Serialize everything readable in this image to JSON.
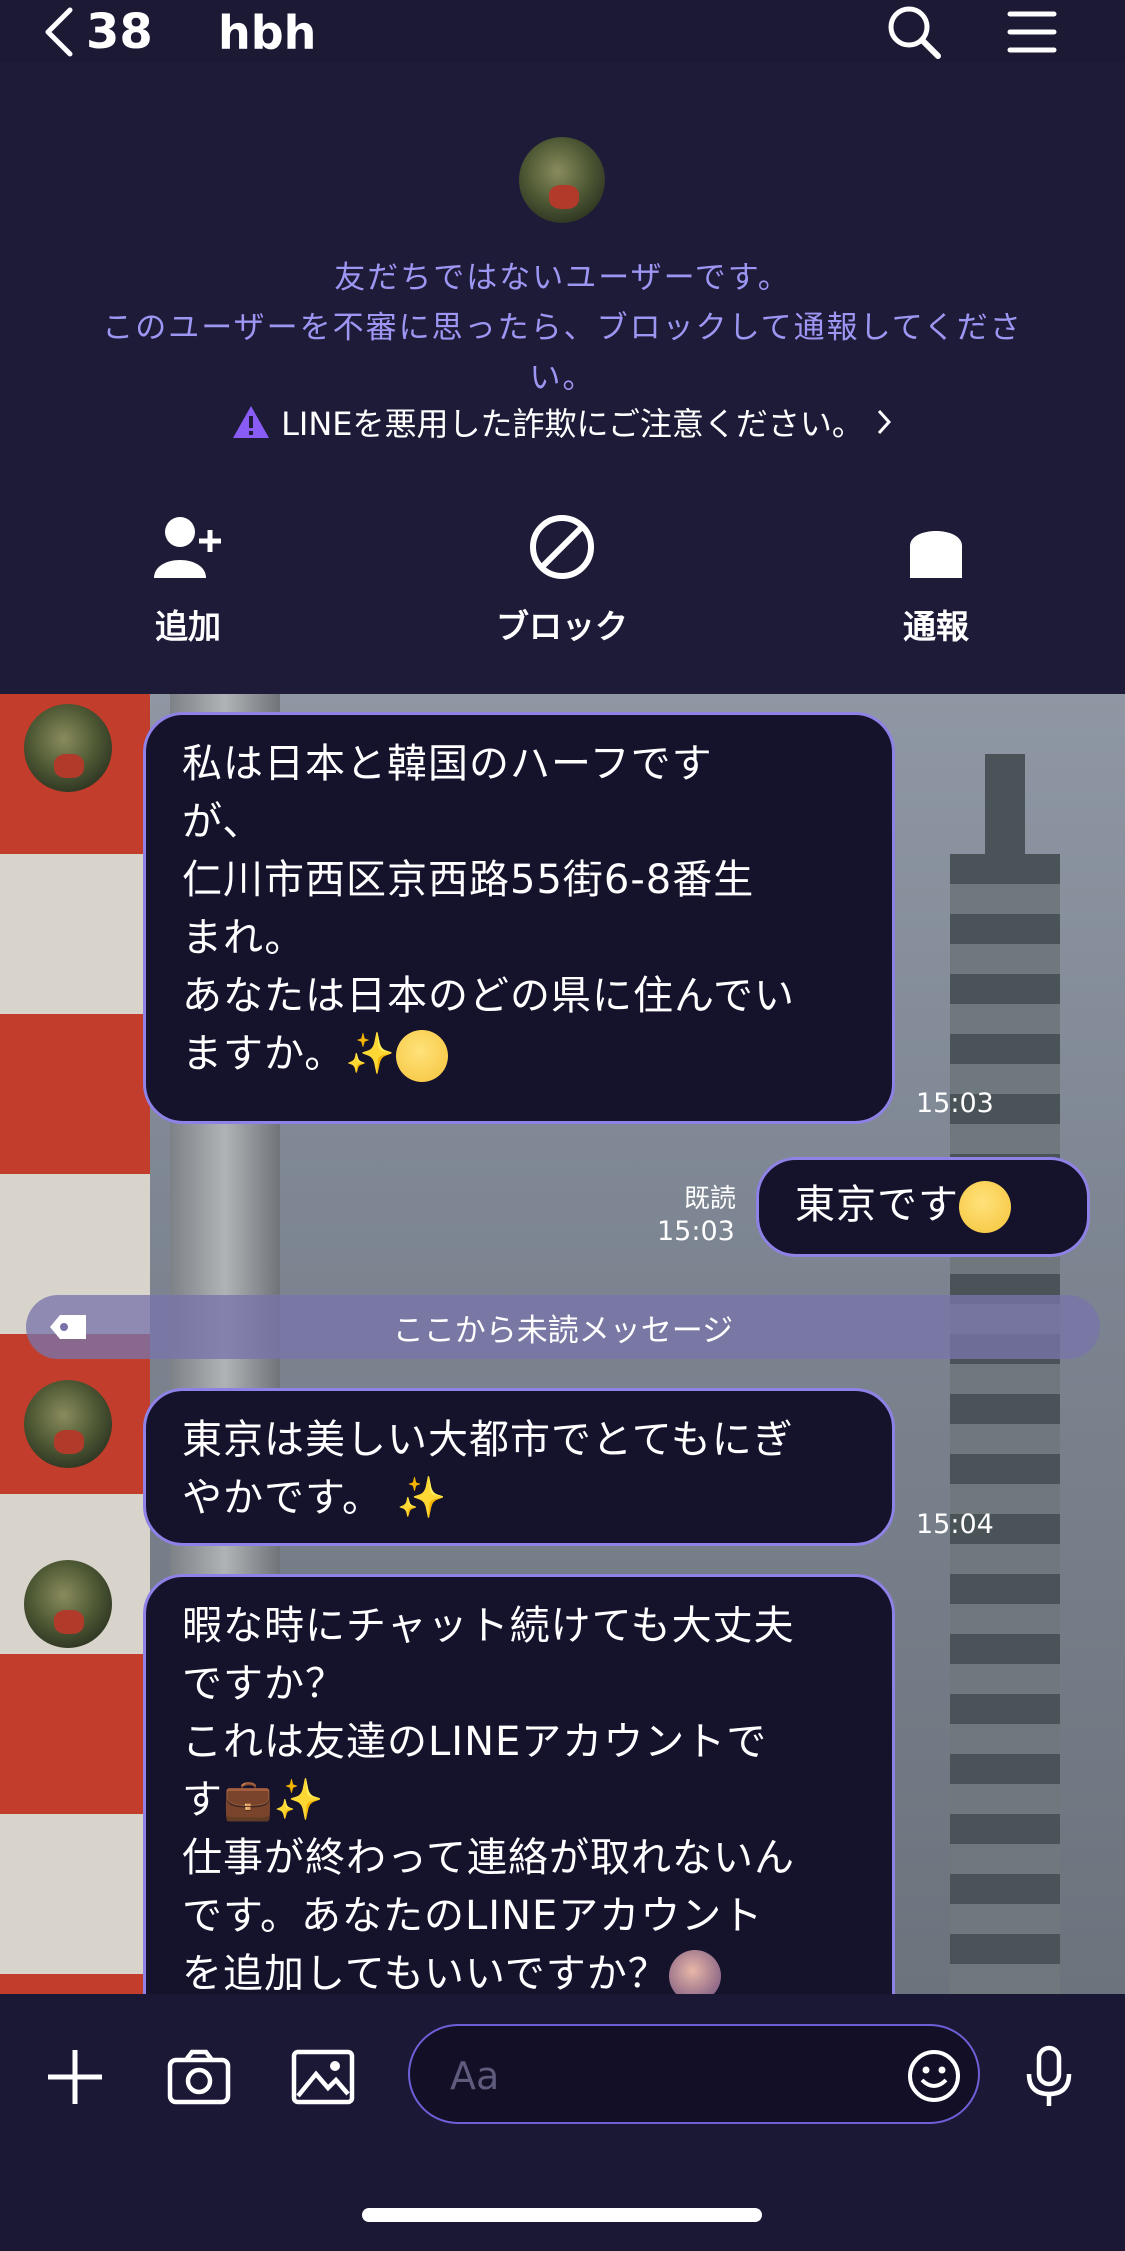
{
  "header": {
    "back_count": "38",
    "title": "hbh",
    "search_icon": "search-icon",
    "menu_icon": "menu-icon"
  },
  "notice": {
    "line1": "友だちではないユーザーです。",
    "line2": "このユーザーを不審に思ったら、ブロックして通報してくださ",
    "line3": "い。",
    "warning": "LINEを悪用した詐欺にご注意ください。"
  },
  "actions": {
    "add": "追加",
    "block": "ブロック",
    "report": "通報"
  },
  "messages": {
    "m1": {
      "lines": [
        "私は日本と韓国のハーフです",
        "が、",
        "仁川市西区京西路55街6-8番生",
        "まれ。",
        "あなたは日本のどの県に住んでい",
        "ますか。"
      ],
      "time": "15:03"
    },
    "m2": {
      "text": "東京です",
      "read": "既読",
      "time": "15:03"
    },
    "unread": "ここから未読メッセージ",
    "m3": {
      "lines": [
        "東京は美しい大都市でとてもにぎ",
        "やかです。"
      ],
      "time": "15:04"
    },
    "m4": {
      "lines": [
        "暇な時にチャット続けても大丈夫",
        "ですか？",
        "これは友達のLINEアカウントで",
        "す",
        "仕事が終わって連絡が取れないん",
        "です。あなたのLINEアカウント",
        "を追加してもいいですか？"
      ]
    }
  },
  "input": {
    "placeholder": "Aa"
  },
  "colors": {
    "accent": "#8f82e6",
    "bubble": "#15122c",
    "header_bg": "#1c1935",
    "notice_text": "#9d96f2"
  }
}
